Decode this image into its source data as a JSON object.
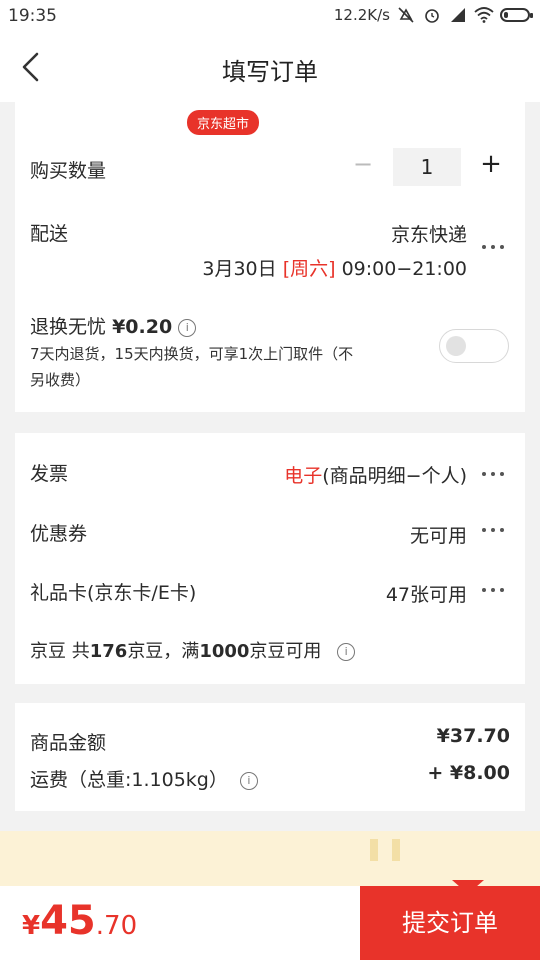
{
  "status_bar": {
    "time": "19:35",
    "network_speed": "12.2K/s"
  },
  "nav": {
    "title": "填写订单"
  },
  "order": {
    "store_tag": "京东超市",
    "quantity_label": "购买数量",
    "quantity_value": "1",
    "minus_symbol": "−",
    "plus_symbol": "+",
    "delivery_label": "配送",
    "delivery_method": "京东快递",
    "delivery_date": "3月30日",
    "delivery_weekday": "[周六]",
    "delivery_time": "09:00−21:00",
    "return_label": "退换无忧",
    "return_price": "¥0.20",
    "return_desc": "7天内退货，15天内换货，可享1次上门取件（不另收费）",
    "return_enabled": false
  },
  "options": {
    "invoice_label": "发票",
    "invoice_type": "电子",
    "invoice_detail": "(商品明细−个人)",
    "coupon_label": "优惠券",
    "coupon_value": "无可用",
    "giftcard_label": "礼品卡(京东卡/E卡)",
    "giftcard_value": "47张可用",
    "jingdou_label": "京豆",
    "jingdou_text_1": "共",
    "jingdou_count": "176",
    "jingdou_text_2": "京豆，满",
    "jingdou_threshold": "1000",
    "jingdou_text_3": "京豆可用"
  },
  "summary": {
    "goods_label": "商品金额",
    "goods_amount": "¥37.70",
    "shipping_label": "运费（总重:1.105kg）",
    "shipping_amount": "+ ¥8.00"
  },
  "bottom": {
    "total_yen": "¥",
    "total_int": "45",
    "total_dec": ".70",
    "submit_label": "提交订单"
  },
  "colors": {
    "accent": "#e8332a",
    "background": "#f2f2f2"
  }
}
